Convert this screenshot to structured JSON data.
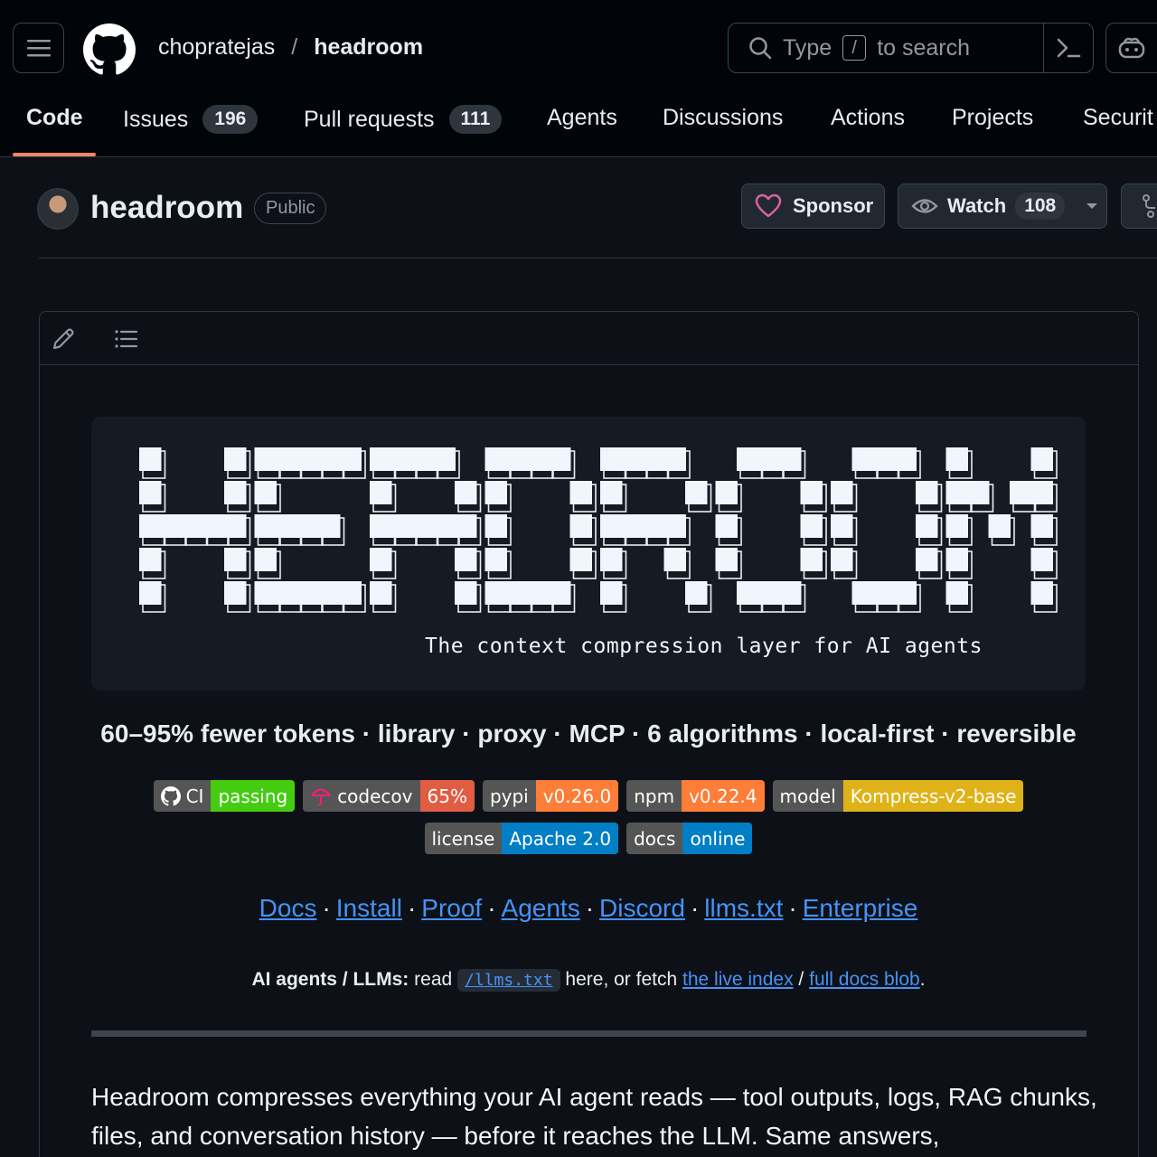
{
  "header": {
    "owner": "chopratejas",
    "separator": "/",
    "repo": "headroom",
    "search_prefix": "Type",
    "search_key": "/",
    "search_suffix": "to search"
  },
  "tabs": [
    {
      "label": "Code",
      "count": ""
    },
    {
      "label": "Issues",
      "count": "196"
    },
    {
      "label": "Pull requests",
      "count": "111"
    },
    {
      "label": "Agents",
      "count": ""
    },
    {
      "label": "Discussions",
      "count": ""
    },
    {
      "label": "Actions",
      "count": ""
    },
    {
      "label": "Projects",
      "count": ""
    },
    {
      "label": "Securit",
      "count": ""
    }
  ],
  "repo_header": {
    "name": "headroom",
    "visibility": "Public",
    "sponsor_label": "Sponsor",
    "watch_label": "Watch",
    "watch_count": "108"
  },
  "readme": {
    "banner_word": "HEADROOM",
    "tagline": "The context compression layer for AI agents",
    "headline": "60–95% fewer tokens · library · proxy · MCP · 6 algorithms · local-first · reversible",
    "badges_row1": [
      {
        "left": "CI",
        "right": "passing",
        "color": "#4c1"
      },
      {
        "left": "codecov",
        "right": "65%",
        "color": "#e05d44"
      },
      {
        "left": "pypi",
        "right": "v0.26.0",
        "color": "#fe7d37"
      },
      {
        "left": "npm",
        "right": "v0.22.4",
        "color": "#fe7d37"
      },
      {
        "left": "model",
        "right": "Kompress-v2-base",
        "color": "#dfb317"
      }
    ],
    "badges_row2": [
      {
        "left": "license",
        "right": "Apache 2.0",
        "color": "#007ec6"
      },
      {
        "left": "docs",
        "right": "online",
        "color": "#007ec6"
      }
    ],
    "links": [
      "Docs",
      "Install",
      "Proof",
      "Agents",
      "Discord",
      "llms.txt",
      "Enterprise"
    ],
    "link_separator": "·",
    "agents_bold": "AI agents / LLMs:",
    "agents_read": "read",
    "agents_code": "/llms.txt",
    "agents_mid": "here, or fetch",
    "agents_link1": "the live index",
    "agents_slash": "/",
    "agents_link2": "full docs blob",
    "agents_end": ".",
    "paragraph": "Headroom compresses everything your AI agent reads — tool outputs, logs, RAG chunks, files, and conversation history — before it reaches the LLM. Same answers,"
  },
  "colors": {
    "accent_underline": "#f78166",
    "link": "#4493f8",
    "sponsor_heart": "#db61a2"
  }
}
